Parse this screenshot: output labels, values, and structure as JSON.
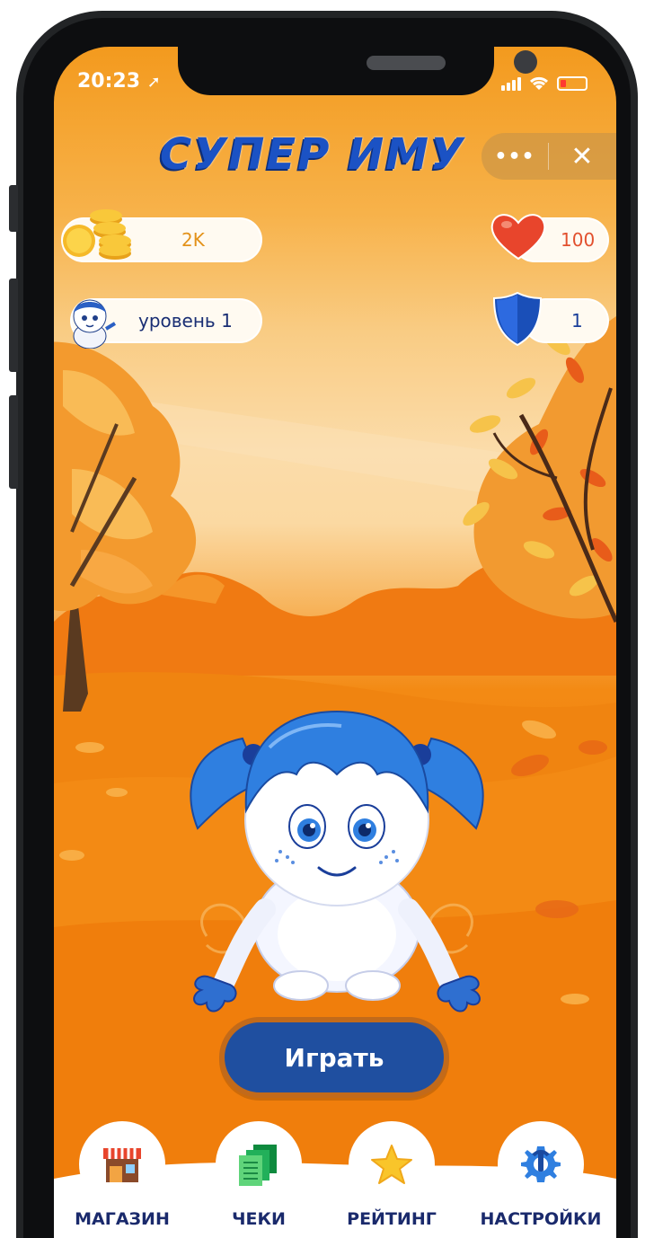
{
  "status_bar": {
    "time": "20:23"
  },
  "header": {
    "title": "СУПЕР ИМУ",
    "menu_dots": "•••",
    "close": "✕"
  },
  "stats": {
    "coins": "2K",
    "level": "уровень 1",
    "health": "100",
    "shield": "1"
  },
  "main": {
    "play_label": "Играть"
  },
  "tabs": [
    {
      "label": "МАГАЗИН",
      "icon": "shop-icon"
    },
    {
      "label": "ЧЕКИ",
      "icon": "receipts-icon"
    },
    {
      "label": "РЕЙТИНГ",
      "icon": "star-icon"
    },
    {
      "label": "НАСТРОЙКИ",
      "icon": "settings-icon"
    }
  ],
  "colors": {
    "title_blue": "#1b52c4",
    "play_button": "#1f4fa0",
    "heart": "#e8452c",
    "shield": "#1a4fb8",
    "tab_label": "#1a2a6c"
  }
}
